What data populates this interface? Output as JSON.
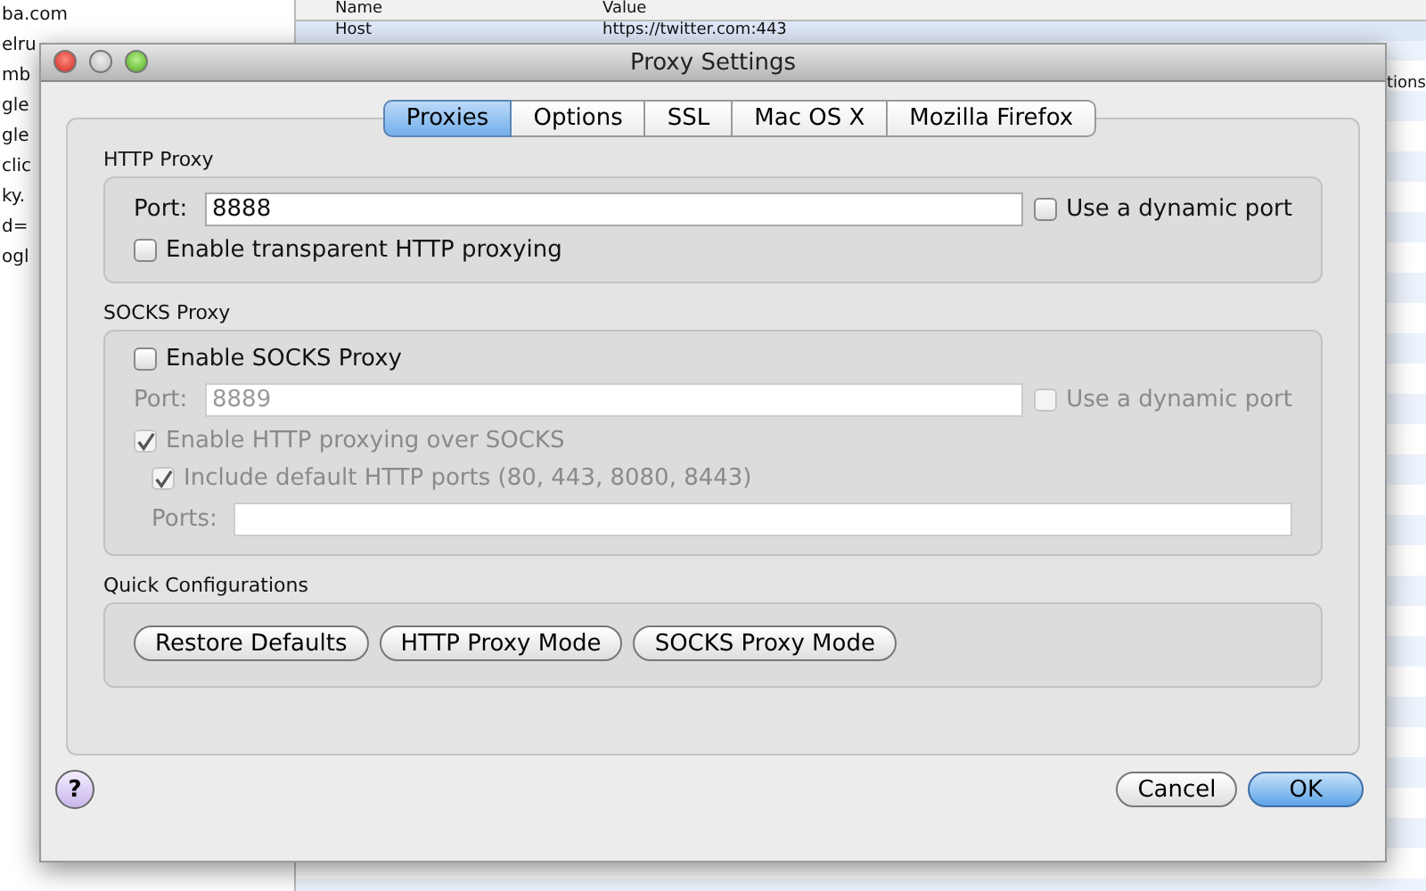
{
  "background": {
    "sidebar_items": [
      "ba.com",
      "elru",
      "mb",
      "gle",
      "gle",
      "clic",
      "ky.",
      "d=",
      "ogl"
    ],
    "columns": [
      "Name",
      "Value"
    ],
    "row": {
      "name": "Host",
      "value": "https://twitter.com:443"
    },
    "side_text": "tions"
  },
  "window": {
    "title": "Proxy Settings"
  },
  "tabs": [
    {
      "label": "Proxies",
      "selected": true
    },
    {
      "label": "Options",
      "selected": false
    },
    {
      "label": "SSL",
      "selected": false
    },
    {
      "label": "Mac OS X",
      "selected": false
    },
    {
      "label": "Mozilla Firefox",
      "selected": false
    }
  ],
  "groups": [
    {
      "title": "HTTP Proxy",
      "rows": [
        {
          "kind": "port",
          "label": "Port:",
          "value": "8888",
          "disabled": false,
          "checkbox": {
            "label": "Use a dynamic port",
            "checked": false,
            "disabled": false
          }
        },
        {
          "kind": "checkbox",
          "label": "Enable transparent HTTP proxying",
          "checked": false,
          "disabled": false
        }
      ]
    },
    {
      "title": "SOCKS Proxy",
      "rows": [
        {
          "kind": "checkbox",
          "label": "Enable SOCKS Proxy",
          "checked": false,
          "disabled": false
        },
        {
          "kind": "port",
          "label": "Port:",
          "value": "8889",
          "disabled": true,
          "checkbox": {
            "label": "Use a dynamic port",
            "checked": false,
            "disabled": true
          }
        },
        {
          "kind": "checkbox",
          "label": "Enable HTTP proxying over SOCKS",
          "checked": true,
          "disabled": true,
          "children": [
            {
              "kind": "checkbox",
              "label": "Include default HTTP ports (80, 443, 8080, 8443)",
              "checked": true,
              "disabled": true
            },
            {
              "kind": "field",
              "label": "Ports:",
              "disabled": true
            }
          ]
        }
      ]
    },
    {
      "title": "Quick Configurations",
      "rows": [
        {
          "kind": "buttons",
          "buttons": [
            "Restore Defaults",
            "HTTP Proxy Mode",
            "SOCKS Proxy Mode"
          ]
        }
      ]
    }
  ],
  "help_button": "?",
  "buttons": [
    {
      "label": "Cancel",
      "default": false
    },
    {
      "label": "OK",
      "default": true
    }
  ]
}
